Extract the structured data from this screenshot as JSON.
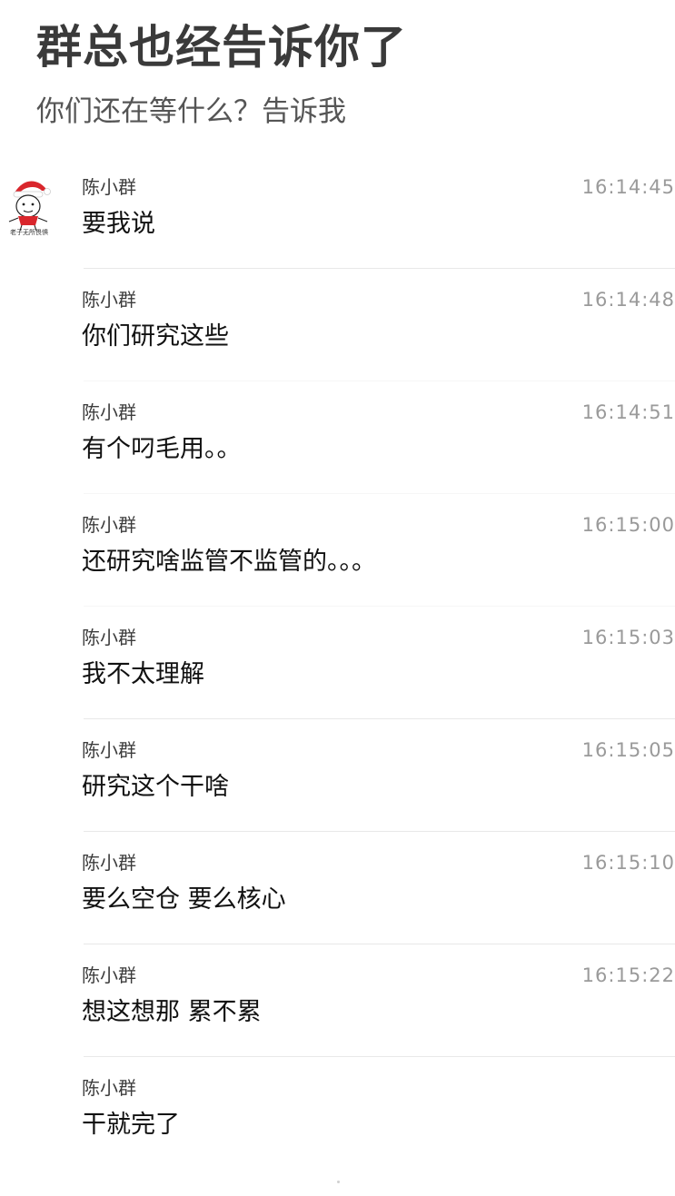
{
  "header": {
    "title": "群总也经告诉你了",
    "subtitle": "你们还在等什么？告诉我"
  },
  "avatar": {
    "icon": "cartoon-santa-hat-face-icon",
    "caption": "老子无所畏惧"
  },
  "colors": {
    "title": "#3a3a3a",
    "timestamp": "#9a9a9a",
    "divider": "#e8e8e8",
    "santa_hat": "#d9262c"
  },
  "messages": [
    {
      "sender": "陈小群",
      "time": "16:14:45",
      "text": "要我说"
    },
    {
      "sender": "陈小群",
      "time": "16:14:48",
      "text": "你们研究这些"
    },
    {
      "sender": "陈小群",
      "time": "16:14:51",
      "text": "有个叼毛用。。"
    },
    {
      "sender": "陈小群",
      "time": "16:15:00",
      "text": "还研究啥监管不监管的。。。"
    },
    {
      "sender": "陈小群",
      "time": "16:15:03",
      "text": "我不太理解"
    },
    {
      "sender": "陈小群",
      "time": "16:15:05",
      "text": "研究这个干啥"
    },
    {
      "sender": "陈小群",
      "time": "16:15:10",
      "text": "要么空仓 要么核心"
    },
    {
      "sender": "陈小群",
      "time": "16:15:22",
      "text": "想这想那  累不累"
    },
    {
      "sender": "陈小群",
      "time": "",
      "text": "干就完了"
    }
  ]
}
